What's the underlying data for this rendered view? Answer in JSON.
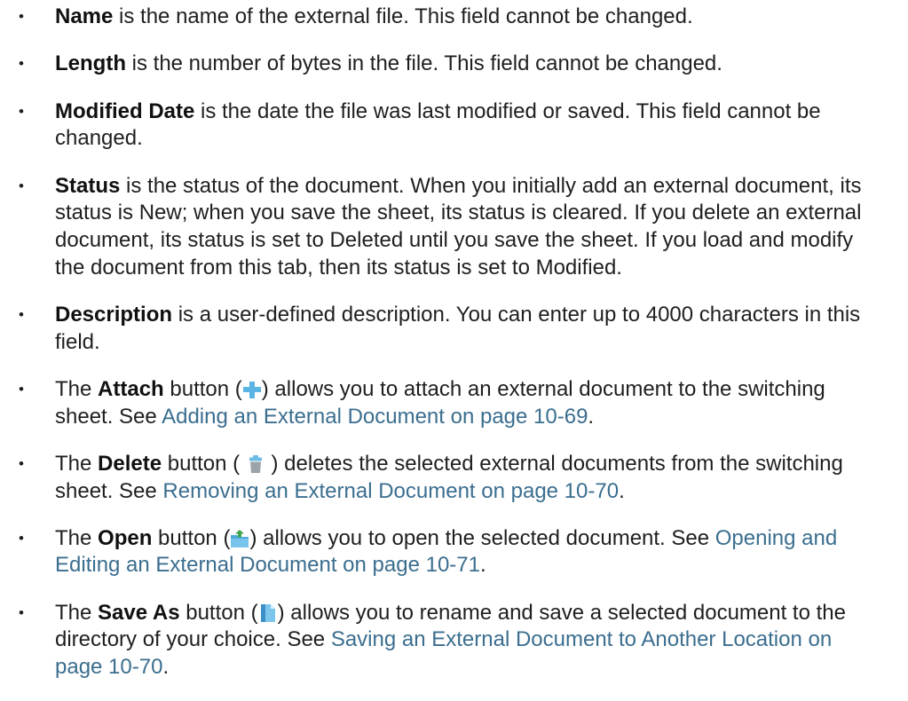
{
  "bullet_glyph": "•",
  "colors": {
    "text": "#1f1f1f",
    "link": "#3b6e8f"
  },
  "items": [
    {
      "term": "Name",
      "lines": [
        " is the name of the external file. This field cannot be changed."
      ]
    },
    {
      "term": "Length",
      "lines": [
        " is the number of bytes in the file. This field cannot be changed."
      ]
    },
    {
      "term": "Modified Date",
      "lines": [
        " is the date the file was last modified or saved. This field cannot be",
        "changed."
      ]
    },
    {
      "term": "Status",
      "lines": [
        " is the status of the document. When you initially add an external document, its",
        "status is New; when you save the sheet, its status is cleared. If you delete an external",
        "document, its status is set to Deleted until you save the sheet. If you load and modify",
        "the document from this tab, then its status is set to Modified."
      ]
    },
    {
      "term": "Description",
      "lines": [
        " is a user-defined description. You can enter up to 4000 characters in this",
        "field."
      ]
    },
    {
      "lead": "The ",
      "term": "Attach",
      "pre_icon": " button (",
      "icon": "attach-icon",
      "post_icon": ") allows you to attach an external document to the switching",
      "line2": "sheet. See ",
      "link": [
        "Adding an External Document on page 10-69"
      ],
      "tail": "."
    },
    {
      "lead": "The ",
      "term": "Delete",
      "pre_icon": " button ( ",
      "icon": "trash-icon",
      "post_icon": " ) deletes the selected external documents from the switching",
      "line2": "sheet. See ",
      "link": [
        "Removing an External Document on page 10-70"
      ],
      "tail": "."
    },
    {
      "lead": "The ",
      "term": "Open",
      "pre_icon": " button (",
      "icon": "open-folder-icon",
      "post_icon": ") allows you to open the selected document. See ",
      "link": [
        "Opening and",
        "Editing an External Document on page 10-71"
      ],
      "tail": "."
    },
    {
      "lead": "The ",
      "term": "Save As",
      "pre_icon": " button (",
      "icon": "save-as-icon",
      "post_icon": ") allows you to rename and save a selected document to the",
      "line2": "directory of your choice. See ",
      "link": [
        "Saving an External Document to Another Location on",
        "page 10-70"
      ],
      "tail": "."
    }
  ]
}
